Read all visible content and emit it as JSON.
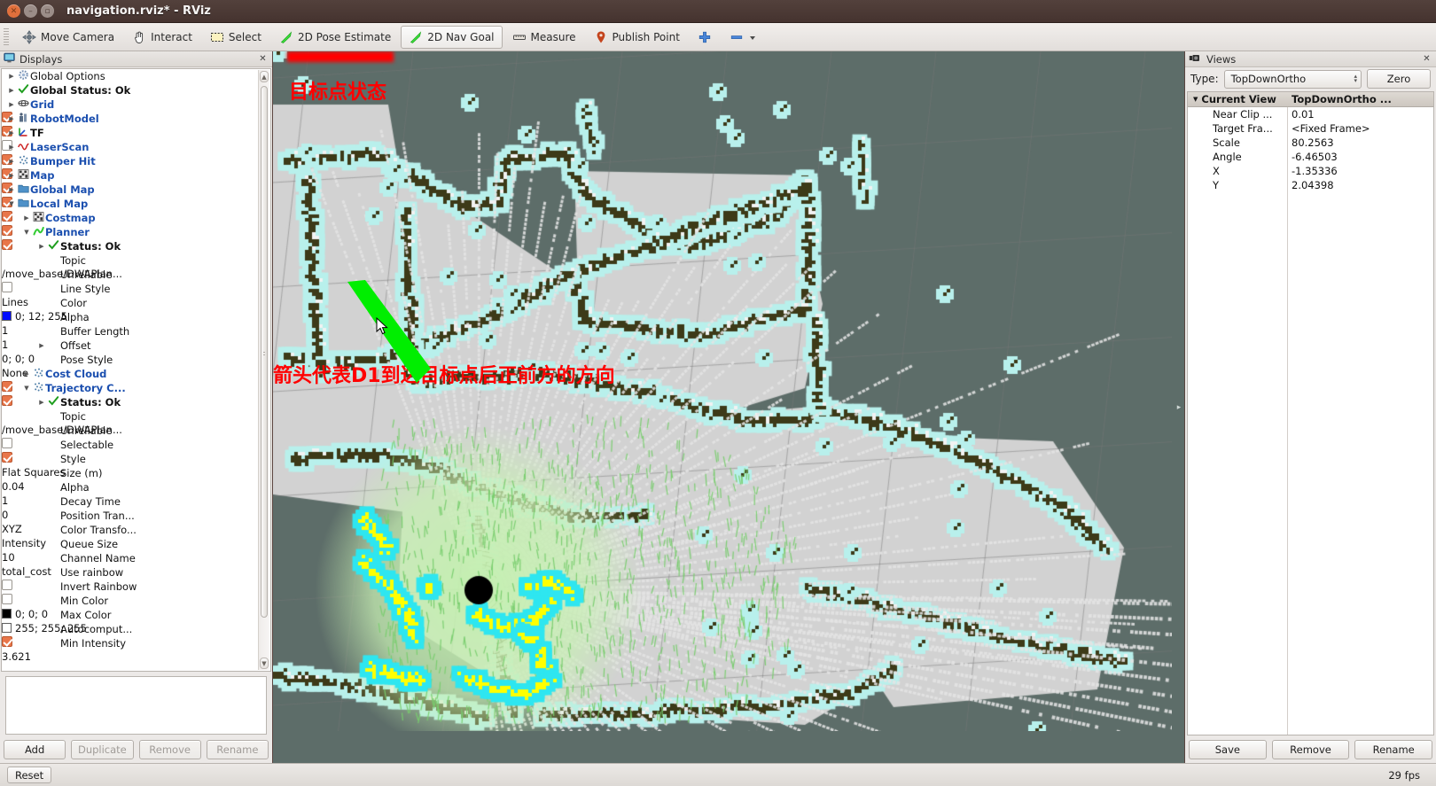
{
  "window": {
    "title": "navigation.rviz* - RViz",
    "close_icon": "close-icon",
    "minimize_icon": "minimize-icon",
    "maximize_icon": "maximize-icon"
  },
  "toolbar": {
    "items": [
      {
        "label": "Move Camera",
        "icon": "move-camera-icon",
        "active": false
      },
      {
        "label": "Interact",
        "icon": "hand-pointer-icon",
        "active": false
      },
      {
        "label": "Select",
        "icon": "selection-box-icon",
        "active": false
      },
      {
        "label": "2D Pose Estimate",
        "icon": "green-arrow-icon",
        "active": false
      },
      {
        "label": "2D Nav Goal",
        "icon": "green-arrow-icon",
        "active": true
      },
      {
        "label": "Measure",
        "icon": "ruler-icon",
        "active": false
      },
      {
        "label": "Publish Point",
        "icon": "map-pin-icon",
        "active": false
      }
    ],
    "plus_icon": "plus-icon",
    "minus_icon": "minus-icon",
    "overflow_icon": "chevron-down-icon"
  },
  "displays": {
    "panel_title": "Displays",
    "panel_icon": "displays-monitor-icon",
    "close_icon": "close-icon",
    "rows": [
      {
        "indent": 0,
        "arrow": "right",
        "icon": "gear-icon",
        "label": "Global Options",
        "style": "plain",
        "value_type": "none"
      },
      {
        "indent": 0,
        "arrow": "right",
        "icon": "check-icon",
        "label": "Global Status: Ok",
        "style": "bold-dark",
        "value_type": "none"
      },
      {
        "indent": 0,
        "arrow": "right",
        "icon": "grid-icon",
        "label": "Grid",
        "style": "link",
        "value_type": "checkbox",
        "checked": true
      },
      {
        "indent": 0,
        "arrow": "right",
        "icon": "robot-icon",
        "label": "RobotModel",
        "style": "link",
        "value_type": "checkbox",
        "checked": true
      },
      {
        "indent": 0,
        "arrow": "right",
        "icon": "tf-axes-icon",
        "label": "TF",
        "style": "plain-bold",
        "value_type": "checkbox",
        "checked": false
      },
      {
        "indent": 0,
        "arrow": "right",
        "icon": "laserscan-icon",
        "label": "LaserScan",
        "style": "link",
        "value_type": "checkbox",
        "checked": true
      },
      {
        "indent": 0,
        "arrow": "right",
        "icon": "pointcloud-icon",
        "label": "Bumper Hit",
        "style": "link",
        "value_type": "checkbox",
        "checked": true
      },
      {
        "indent": 0,
        "arrow": "right",
        "icon": "map-grid-icon",
        "label": "Map",
        "style": "link",
        "value_type": "checkbox",
        "checked": true
      },
      {
        "indent": 0,
        "arrow": "right",
        "icon": "group-icon",
        "label": "Global Map",
        "style": "link",
        "value_type": "checkbox",
        "checked": true
      },
      {
        "indent": 0,
        "arrow": "down",
        "icon": "group-icon",
        "label": "Local Map",
        "style": "link",
        "value_type": "checkbox",
        "checked": true
      },
      {
        "indent": 1,
        "arrow": "right",
        "icon": "map-grid-icon",
        "label": "Costmap",
        "style": "link",
        "value_type": "checkbox",
        "checked": true
      },
      {
        "indent": 1,
        "arrow": "down",
        "icon": "path-icon",
        "label": "Planner",
        "style": "link",
        "value_type": "checkbox",
        "checked": true
      },
      {
        "indent": 2,
        "arrow": "right",
        "icon": "check-icon",
        "label": "Status: Ok",
        "style": "bold-dark",
        "value_type": "none"
      },
      {
        "indent": 2,
        "arrow": "none",
        "icon": "none",
        "label": "Topic",
        "style": "plain",
        "value_type": "text",
        "value": "/move_base/DWAPlan..."
      },
      {
        "indent": 2,
        "arrow": "none",
        "icon": "none",
        "label": "Unreliable",
        "style": "plain",
        "value_type": "checkbox",
        "checked": false
      },
      {
        "indent": 2,
        "arrow": "none",
        "icon": "none",
        "label": "Line Style",
        "style": "plain",
        "value_type": "text",
        "value": "Lines"
      },
      {
        "indent": 2,
        "arrow": "none",
        "icon": "none",
        "label": "Color",
        "style": "plain",
        "value_type": "color",
        "value": "0; 12; 255",
        "swatch": "#000cff"
      },
      {
        "indent": 2,
        "arrow": "none",
        "icon": "none",
        "label": "Alpha",
        "style": "plain",
        "value_type": "text",
        "value": "1"
      },
      {
        "indent": 2,
        "arrow": "none",
        "icon": "none",
        "label": "Buffer Length",
        "style": "plain",
        "value_type": "text",
        "value": "1"
      },
      {
        "indent": 2,
        "arrow": "right",
        "icon": "none",
        "label": "Offset",
        "style": "plain",
        "value_type": "text",
        "value": "0; 0; 0"
      },
      {
        "indent": 2,
        "arrow": "none",
        "icon": "none",
        "label": "Pose Style",
        "style": "plain",
        "value_type": "text",
        "value": "None"
      },
      {
        "indent": 1,
        "arrow": "right",
        "icon": "pointcloud-icon",
        "label": "Cost Cloud",
        "style": "link",
        "value_type": "checkbox",
        "checked": true
      },
      {
        "indent": 1,
        "arrow": "down",
        "icon": "pointcloud-icon",
        "label": "Trajectory C...",
        "style": "link",
        "value_type": "checkbox",
        "checked": true
      },
      {
        "indent": 2,
        "arrow": "right",
        "icon": "check-icon",
        "label": "Status: Ok",
        "style": "bold-dark",
        "value_type": "none"
      },
      {
        "indent": 2,
        "arrow": "none",
        "icon": "none",
        "label": "Topic",
        "style": "plain",
        "value_type": "text",
        "value": "/move_base/DWAPlan..."
      },
      {
        "indent": 2,
        "arrow": "none",
        "icon": "none",
        "label": "Unreliable",
        "style": "plain",
        "value_type": "checkbox",
        "checked": false
      },
      {
        "indent": 2,
        "arrow": "none",
        "icon": "none",
        "label": "Selectable",
        "style": "plain",
        "value_type": "checkbox",
        "checked": true
      },
      {
        "indent": 2,
        "arrow": "none",
        "icon": "none",
        "label": "Style",
        "style": "plain",
        "value_type": "text",
        "value": "Flat Squares"
      },
      {
        "indent": 2,
        "arrow": "none",
        "icon": "none",
        "label": "Size (m)",
        "style": "plain",
        "value_type": "text",
        "value": "0.04"
      },
      {
        "indent": 2,
        "arrow": "none",
        "icon": "none",
        "label": "Alpha",
        "style": "plain",
        "value_type": "text",
        "value": "1"
      },
      {
        "indent": 2,
        "arrow": "none",
        "icon": "none",
        "label": "Decay Time",
        "style": "plain",
        "value_type": "text",
        "value": "0"
      },
      {
        "indent": 2,
        "arrow": "none",
        "icon": "none",
        "label": "Position Tran...",
        "style": "plain",
        "value_type": "text",
        "value": "XYZ"
      },
      {
        "indent": 2,
        "arrow": "none",
        "icon": "none",
        "label": "Color Transfo...",
        "style": "plain",
        "value_type": "text",
        "value": "Intensity"
      },
      {
        "indent": 2,
        "arrow": "none",
        "icon": "none",
        "label": "Queue Size",
        "style": "plain",
        "value_type": "text",
        "value": "10"
      },
      {
        "indent": 2,
        "arrow": "none",
        "icon": "none",
        "label": "Channel Name",
        "style": "plain",
        "value_type": "text",
        "value": "total_cost"
      },
      {
        "indent": 2,
        "arrow": "none",
        "icon": "none",
        "label": "Use rainbow",
        "style": "plain",
        "value_type": "checkbox",
        "checked": false
      },
      {
        "indent": 2,
        "arrow": "none",
        "icon": "none",
        "label": "Invert Rainbow",
        "style": "plain",
        "value_type": "checkbox",
        "checked": false
      },
      {
        "indent": 2,
        "arrow": "none",
        "icon": "none",
        "label": "Min Color",
        "style": "plain",
        "value_type": "color",
        "value": "0; 0; 0",
        "swatch": "#000000"
      },
      {
        "indent": 2,
        "arrow": "none",
        "icon": "none",
        "label": "Max Color",
        "style": "plain",
        "value_type": "color",
        "value": "255; 255; 255",
        "swatch": "#ffffff"
      },
      {
        "indent": 2,
        "arrow": "none",
        "icon": "none",
        "label": "Autocomput...",
        "style": "plain",
        "value_type": "checkbox",
        "checked": true
      },
      {
        "indent": 2,
        "arrow": "none",
        "icon": "none",
        "label": "Min Intensity",
        "style": "plain",
        "value_type": "text",
        "value": "3.621"
      }
    ],
    "buttons": [
      {
        "label": "Add",
        "disabled": false
      },
      {
        "label": "Duplicate",
        "disabled": true
      },
      {
        "label": "Remove",
        "disabled": true
      },
      {
        "label": "Rename",
        "disabled": true
      }
    ]
  },
  "views": {
    "panel_title": "Views",
    "panel_icon": "views-camera-icon",
    "close_icon": "close-icon",
    "type_label": "Type:",
    "type_value": "TopDownOrtho",
    "zero_button": "Zero",
    "columns": [
      "Current View",
      "TopDownOrtho ..."
    ],
    "rows": [
      {
        "label": "Near Clip ...",
        "value": "0.01"
      },
      {
        "label": "Target Fra...",
        "value": "<Fixed Frame>"
      },
      {
        "label": "Scale",
        "value": "80.2563"
      },
      {
        "label": "Angle",
        "value": "-6.46503"
      },
      {
        "label": "X",
        "value": "-1.35336"
      },
      {
        "label": "Y",
        "value": "2.04398"
      }
    ],
    "buttons": [
      {
        "label": "Save",
        "disabled": false
      },
      {
        "label": "Remove",
        "disabled": false
      },
      {
        "label": "Rename",
        "disabled": false
      }
    ]
  },
  "view3d": {
    "annotations": [
      {
        "name": "goal-state",
        "text": "目标点状态"
      },
      {
        "name": "arrow-direction",
        "text": "箭头代表D1到达目标点后正前方的方向"
      }
    ],
    "goal_arrow_color": "#00ee00",
    "robot_marker_color": "#000000",
    "background_color": "#5d6d69",
    "free_space_color": "#d2d2d2",
    "obstacle_color": "#3d3a18",
    "inflation_color": "#b8f0ec",
    "lethal_color": "#ffff00",
    "cost_cloud_color": "#c8f0b4"
  },
  "statusbar": {
    "reset_label": "Reset",
    "fps": "29 fps"
  }
}
